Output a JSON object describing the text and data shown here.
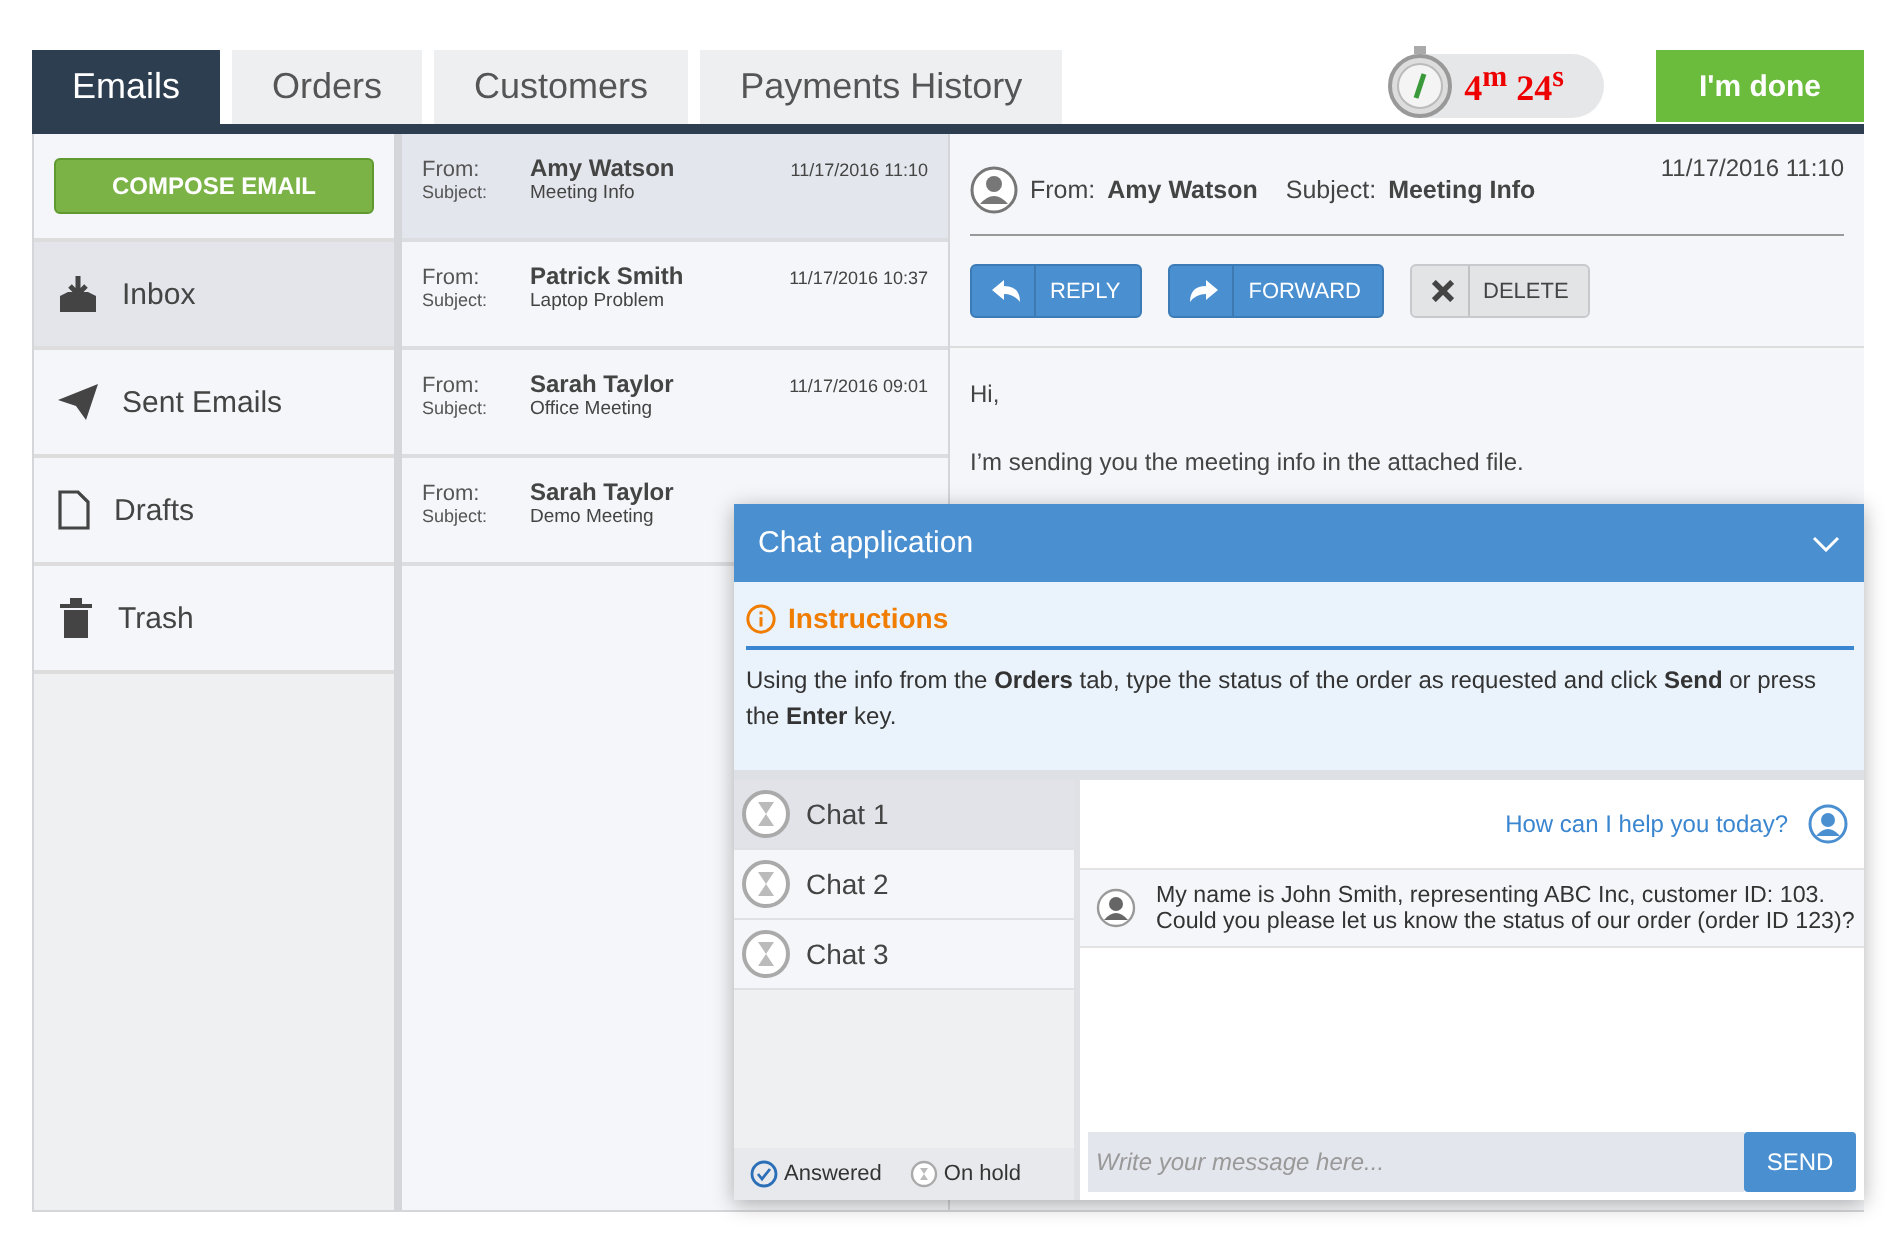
{
  "tabs": [
    {
      "label": "Emails",
      "selected": true
    },
    {
      "label": "Orders",
      "selected": false
    },
    {
      "label": "Customers",
      "selected": false
    },
    {
      "label": "Payments History",
      "selected": false
    }
  ],
  "timer": {
    "text": "4$^{m}$ 24$^{s}$"
  },
  "done_button": "I'm done",
  "compose_button": "COMPOSE EMAIL",
  "folders": [
    {
      "label": "Inbox",
      "kind": "inbox",
      "selected": true
    },
    {
      "label": "Sent Emails",
      "kind": "sent",
      "selected": false
    },
    {
      "label": "Drafts",
      "kind": "drafts",
      "selected": false
    },
    {
      "label": "Trash",
      "kind": "trash",
      "selected": false
    }
  ],
  "emails": [
    {
      "from_label": "From:",
      "from": "Amy Watson",
      "subject_label": "Subject:",
      "subject": "Meeting Info",
      "date": "11/17/2016 11:10",
      "selected": true
    },
    {
      "from_label": "From:",
      "from": "Patrick Smith",
      "subject_label": "Subject:",
      "subject": "Laptop Problem",
      "date": "11/17/2016 10:37",
      "selected": false
    },
    {
      "from_label": "From:",
      "from": "Sarah Taylor",
      "subject_label": "Subject:",
      "subject": "Office Meeting",
      "date": "11/17/2016 09:01",
      "selected": false
    },
    {
      "from_label": "From:",
      "from": "Sarah Taylor",
      "subject_label": "Subject:",
      "subject": "Demo Meeting",
      "selected": false
    }
  ],
  "reading": {
    "from_label": "From:",
    "from": "Amy Watson",
    "subject_label": "Subject:",
    "subject": "Meeting Info",
    "date": "11/17/2016 11:10",
    "actions": [
      {
        "label": "REPLY",
        "kind": "reply"
      },
      {
        "label": "FORWARD",
        "kind": "forward"
      },
      {
        "label": "DELETE",
        "kind": "delete"
      }
    ],
    "body": [
      "Hi,",
      "I’m sending you the meeting info in the attached file."
    ]
  },
  "chat": {
    "title": "Chat application",
    "instructions_title": "Instructions",
    "instructions": "Using the info from the **Orders** tab, type the status of the order as requested and click **Send** or press the **Enter** key.",
    "chats": [
      {
        "label": "Chat 1",
        "selected": true
      },
      {
        "label": "Chat 2",
        "selected": false
      },
      {
        "label": "Chat 3",
        "selected": false
      }
    ],
    "legend": [
      {
        "label": "Answered",
        "kind": "answered"
      },
      {
        "label": "On hold",
        "kind": "hold"
      }
    ],
    "greeting": "How can I help you today?",
    "message": "My name is John Smith, representing ABC Inc, customer ID: 103. Could you please let us know the status of our order (order ID 123)?",
    "placeholder": "Write your message here...",
    "send": "SEND"
  }
}
